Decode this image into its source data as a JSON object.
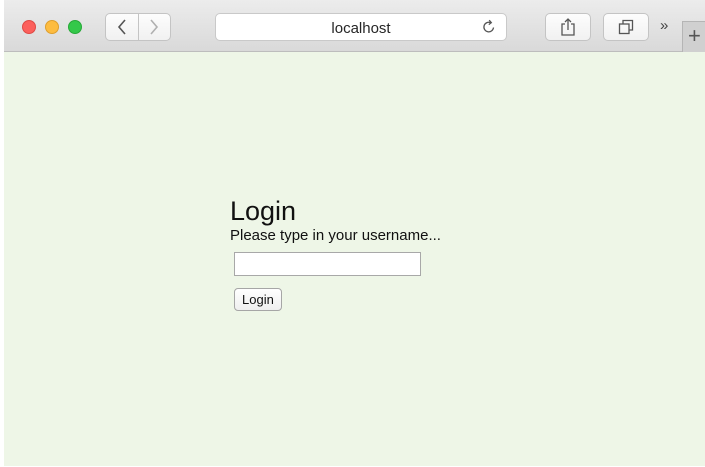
{
  "browser": {
    "address": "localhost",
    "icons": {
      "back": "chevron-left-icon",
      "forward": "chevron-right-icon",
      "reload": "reload-icon",
      "share": "share-icon",
      "tabs": "tabs-overview-icon",
      "more": "chevron-double-right-icon",
      "new_tab": "plus-icon"
    },
    "more_glyph": "»",
    "new_tab_glyph": "+"
  },
  "page": {
    "background": "#eef6e7",
    "heading": "Login",
    "prompt": "Please type in your username...",
    "username_value": "",
    "button_label": "Login"
  }
}
